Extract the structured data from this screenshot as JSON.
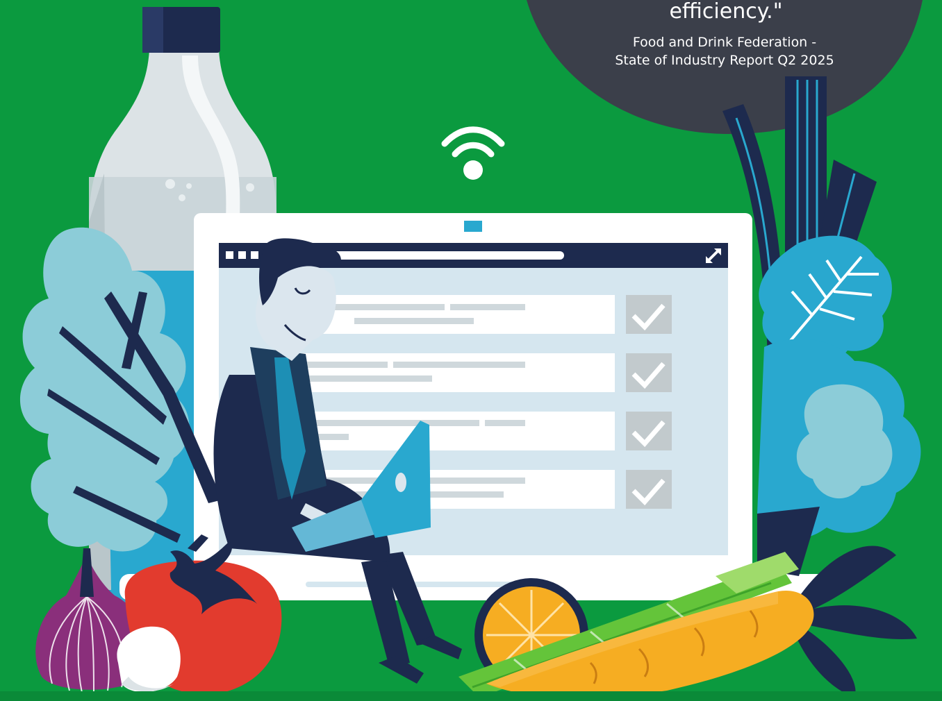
{
  "quote": {
    "text_tail": "efficiency.\"",
    "source_line1": "Food and Drink Federation -",
    "source_line2": "State of Industry Report Q2 2025"
  },
  "colors": {
    "background": "#0b9a3f",
    "bubble": "#3b3f4a",
    "navy": "#1d2a4e",
    "screen": "#d5e6ef",
    "light_blue": "#8cccd8"
  },
  "icons": [
    "wifi-icon",
    "checkmark-icon",
    "expand-icon",
    "window-dots-icon"
  ]
}
